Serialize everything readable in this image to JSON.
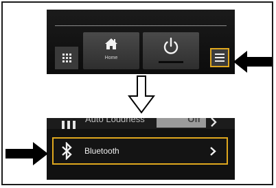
{
  "top_screen": {
    "home_label": "Home",
    "icons": [
      "grid-icon",
      "home-icon",
      "power-icon",
      "menu-icon"
    ],
    "highlight_color": "#e0a81e"
  },
  "bottom_screen": {
    "auto_loudness_label": "Auto Loudness",
    "auto_loudness_value": "Off",
    "bluetooth_label": "Bluetooth",
    "icons": [
      "equalizer-icon",
      "bluetooth-icon",
      "chevron-right-icon"
    ]
  },
  "annotations": {
    "arrow_color": "#000000",
    "pointers": [
      "pointer-arrow-menu",
      "down-arrow",
      "pointer-arrow-bluetooth"
    ]
  }
}
